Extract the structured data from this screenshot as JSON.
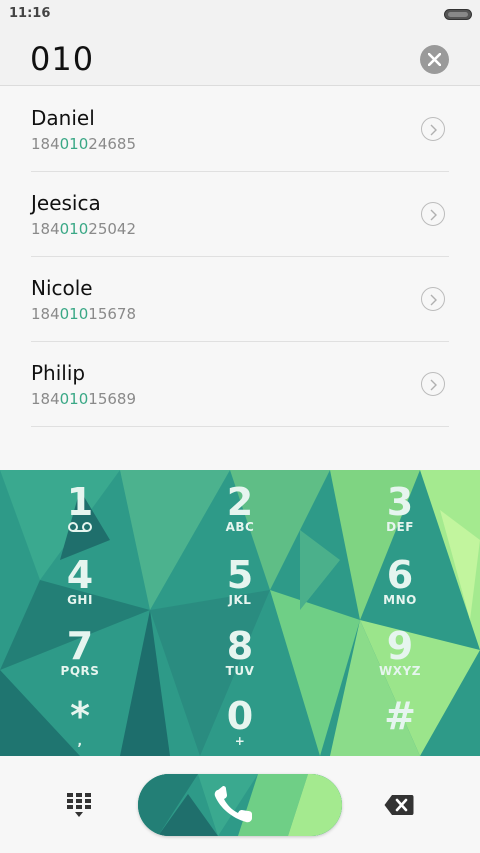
{
  "status": {
    "time": "11:16"
  },
  "search": {
    "query": "010"
  },
  "contacts": [
    {
      "name": "Daniel",
      "pre": "184",
      "match": "010",
      "post": "24685"
    },
    {
      "name": "Jeesica",
      "pre": "184",
      "match": "010",
      "post": "25042"
    },
    {
      "name": "Nicole",
      "pre": "184",
      "match": "010",
      "post": "15678"
    },
    {
      "name": "Philip",
      "pre": "184",
      "match": "010",
      "post": "15689"
    }
  ],
  "keypad": {
    "keys": [
      {
        "digit": "1",
        "letters": ""
      },
      {
        "digit": "2",
        "letters": "ABC"
      },
      {
        "digit": "3",
        "letters": "DEF"
      },
      {
        "digit": "4",
        "letters": "GHI"
      },
      {
        "digit": "5",
        "letters": "JKL"
      },
      {
        "digit": "6",
        "letters": "MNO"
      },
      {
        "digit": "7",
        "letters": "PQRS"
      },
      {
        "digit": "8",
        "letters": "TUV"
      },
      {
        "digit": "9",
        "letters": "WXYZ"
      },
      {
        "digit": "*",
        "letters": ","
      },
      {
        "digit": "0",
        "letters": "+"
      },
      {
        "digit": "#",
        "letters": ""
      }
    ]
  },
  "icons": {
    "voicemail": "voicemail-icon",
    "dialpad": "dialpad-icon",
    "call": "phone-icon",
    "backspace": "backspace-icon",
    "clear": "close-icon",
    "chevron": "chevron-right-icon"
  },
  "colors": {
    "highlight": "#3aa886",
    "keypad_base": "#2e9a88",
    "keypad_light": "#8fe08a"
  }
}
